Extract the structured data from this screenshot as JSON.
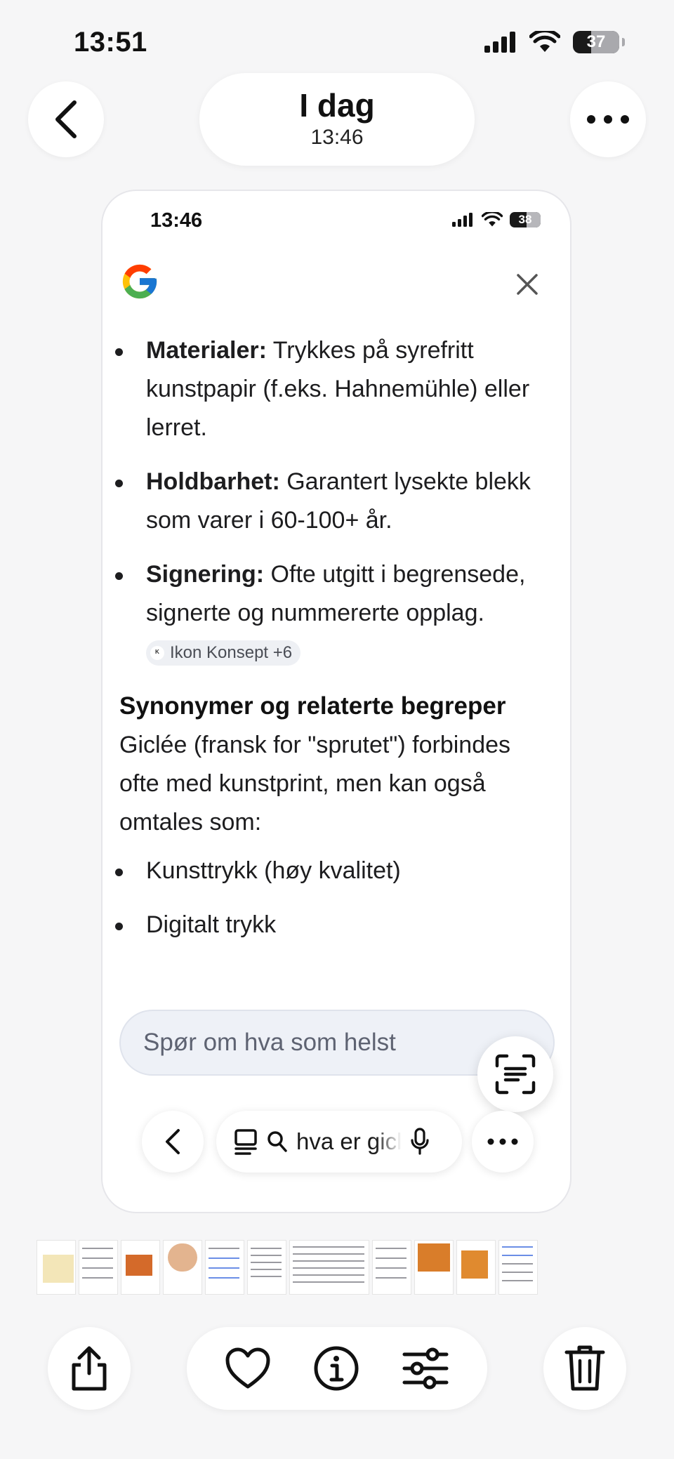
{
  "status_bar": {
    "time": "13:51",
    "battery": "37"
  },
  "header": {
    "title": "I dag",
    "subtitle": "13:46",
    "back_icon": "chevron-left-icon",
    "more_icon": "ellipsis-icon"
  },
  "screenshot": {
    "status_bar": {
      "time": "13:46",
      "battery": "38"
    },
    "bullets_top": [
      {
        "label": "Materialer:",
        "text": " Trykkes på syrefritt kunstpapir (f.eks. Hahnemühle) eller lerret."
      },
      {
        "label": "Holdbarhet:",
        "text": " Garantert lysekte blekk som varer i 60-100+ år."
      },
      {
        "label": "Signering:",
        "text": " Ofte utgitt i begrensede, signerte og nummererte opplag."
      }
    ],
    "source_chip": "Ikon Konsept +6",
    "section_title": "Synonymer og relaterte begreper",
    "section_body": "Giclée (fransk for \"sprutet\") forbindes ofte med kunstprint, men kan også omtales som:",
    "bullets_bottom": [
      "Kunsttrykk (høy kvalitet)",
      "Digitalt trykk"
    ],
    "ask_placeholder": "Spør om hva som helst",
    "search_query": "hva er giclée"
  },
  "toolbar": {
    "icons": [
      "share-icon",
      "heart-icon",
      "info-icon",
      "adjust-icon",
      "trash-icon"
    ]
  },
  "colors": {
    "background": "#f6f6f7",
    "input_bg": "#eef1f7",
    "chip_bg": "#eef0f4"
  }
}
